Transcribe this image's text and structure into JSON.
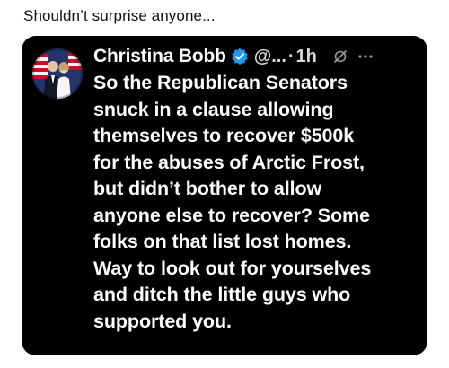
{
  "caption": "Shouldn’t surprise anyone...",
  "tweet": {
    "display_name": "Christina Bobb",
    "handle": "@...",
    "separator": "·",
    "time": "1h",
    "text": "So the Republican Senators\nsnuck in a clause allowing\nthemselves to recover $500k\nfor the abuses of Arctic Frost,\nbut didn’t bother to allow\nanyone else to recover? Some\nfolks on that list lost homes.\nWay to look out for yourselves\nand ditch the little guys who\nsupported you.",
    "verified_badge_color": "#1d9bf0",
    "icons": [
      "avatar-photo",
      "verified-badge-icon",
      "grok-icon",
      "more-options-icon"
    ]
  },
  "colors": {
    "page_background": "#ffffff",
    "card_background": "#000000",
    "text_primary": "#ffffff",
    "text_secondary": "#d9d9d9"
  }
}
